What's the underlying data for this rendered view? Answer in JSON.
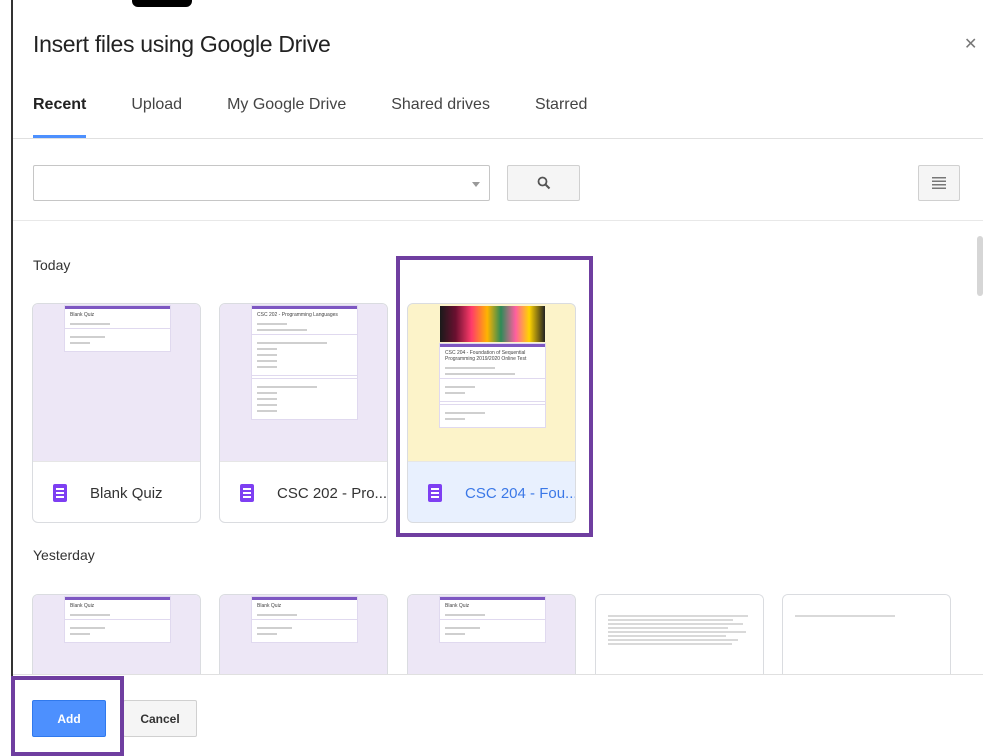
{
  "dialog": {
    "title": "Insert files using Google Drive",
    "close_icon": "close-icon"
  },
  "tabs": [
    {
      "label": "Recent",
      "active": true
    },
    {
      "label": "Upload",
      "active": false
    },
    {
      "label": "My Google Drive",
      "active": false
    },
    {
      "label": "Shared drives",
      "active": false
    },
    {
      "label": "Starred",
      "active": false
    }
  ],
  "search": {
    "value": "",
    "placeholder": "",
    "search_icon": "search-icon",
    "view_icon": "list-view-icon"
  },
  "sections": {
    "today": {
      "label": "Today",
      "files": [
        {
          "name": "Blank Quiz",
          "thumb_title": "Blank Quiz",
          "selected": false
        },
        {
          "name": "CSC 202 - Pro...",
          "thumb_title": "CSC 202 - Programming Languages",
          "selected": false
        },
        {
          "name": "CSC 204 - Fou...",
          "thumb_title": "CSC 204 - Foundation of Sequential Programming 2019/2020 Online Test",
          "selected": true
        }
      ]
    },
    "yesterday": {
      "label": "Yesterday",
      "files": [
        {
          "thumb_title": "Blank Quiz"
        },
        {
          "thumb_title": "Blank Quiz"
        },
        {
          "thumb_title": "Blank Quiz"
        },
        {
          "thumb_title": ""
        },
        {
          "thumb_title": ""
        }
      ]
    }
  },
  "footer": {
    "add_label": "Add",
    "cancel_label": "Cancel"
  },
  "colors": {
    "accent": "#4d90fe",
    "forms_purple": "#7e3ff2",
    "highlight": "#6f3ea0",
    "selected_text": "#3b78e7"
  }
}
